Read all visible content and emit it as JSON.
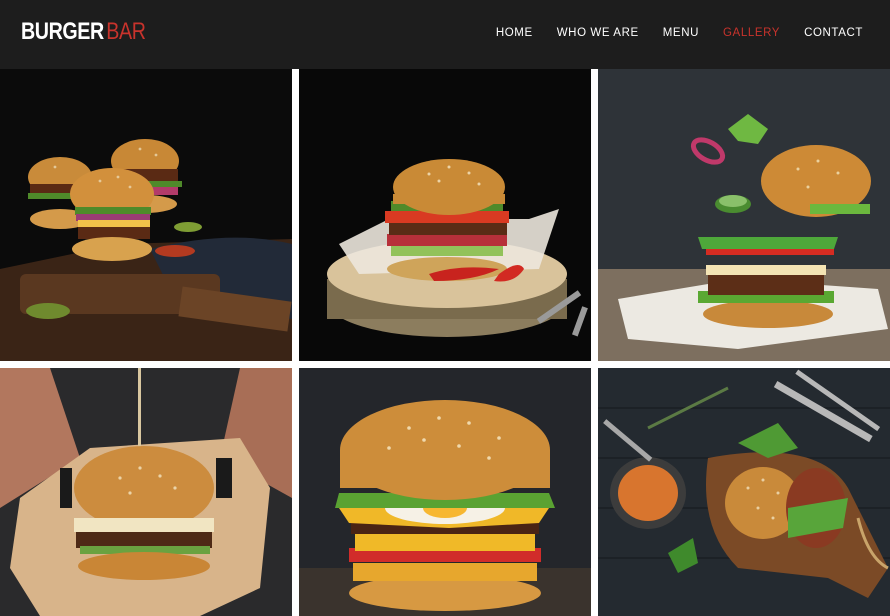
{
  "brand": {
    "part1": "BURGER",
    "part2": "BAR"
  },
  "nav": {
    "items": [
      {
        "label": "HOME",
        "active": false
      },
      {
        "label": "WHO WE ARE",
        "active": false
      },
      {
        "label": "MENU",
        "active": false
      },
      {
        "label": "GALLERY",
        "active": true
      },
      {
        "label": "CONTACT",
        "active": false
      }
    ]
  },
  "colors": {
    "header_bg": "#1d1d1d",
    "accent": "#c8332c",
    "text": "#ffffff"
  },
  "gallery": {
    "images": [
      {
        "subject": "three cheeseburgers on wooden board"
      },
      {
        "subject": "burger on wooden log with chili peppers"
      },
      {
        "subject": "floating deconstructed burger on paper"
      },
      {
        "subject": "burger in paper wrap held with skewer"
      },
      {
        "subject": "double cheeseburger with egg"
      },
      {
        "subject": "burger on cutting board with sauce and cutlery"
      }
    ]
  }
}
